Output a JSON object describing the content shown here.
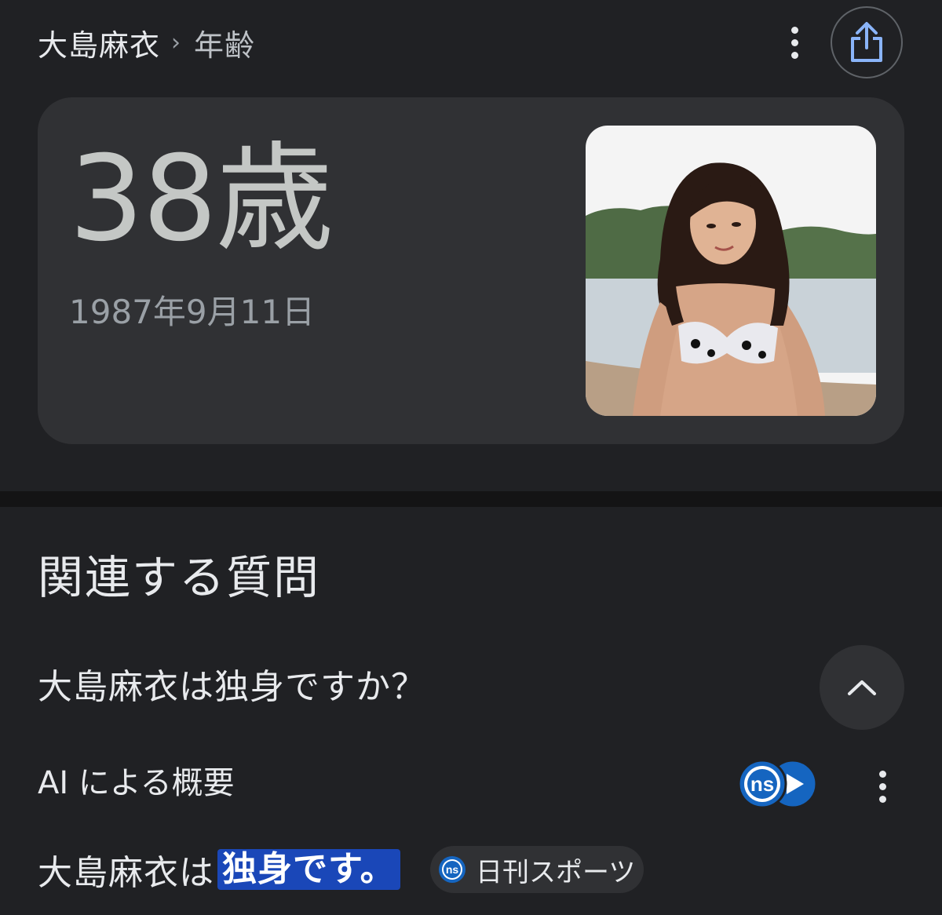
{
  "header": {
    "entity": "大島麻衣",
    "separator": "›",
    "attribute": "年齢",
    "more_icon": "more-vert-icon",
    "share_icon": "share-icon"
  },
  "age_card": {
    "age": "38歳",
    "birthdate": "1987年9月11日"
  },
  "related_questions": {
    "title": "関連する質問",
    "question": "大島麻衣は独身ですか？",
    "expanded": true
  },
  "ai_overview": {
    "label": "AI による概要",
    "source_logo_text": "ns",
    "answer_prefix": "大島麻衣は",
    "answer_highlight": "独身です。",
    "source_name": "日刊スポーツ"
  },
  "colors": {
    "background": "#202124",
    "card": "#303134",
    "highlight": "#1a47b8",
    "source_blue": "#1565c0"
  }
}
